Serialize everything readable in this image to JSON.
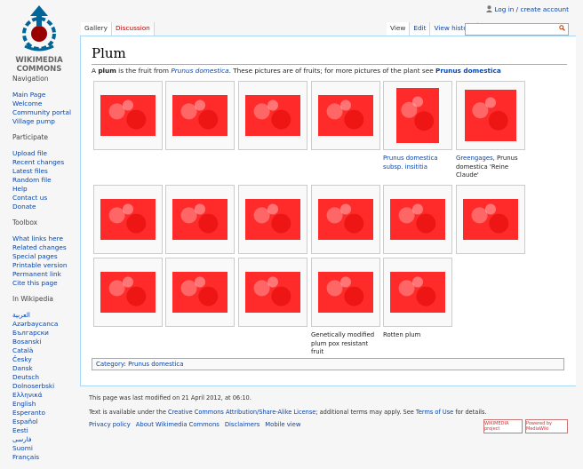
{
  "logo": {
    "line1": "WIKIMEDIA",
    "line2": "COMMONS"
  },
  "personal": {
    "login": "Log in / create account"
  },
  "tabs": {
    "gallery": "Gallery",
    "discussion": "Discussion",
    "view": "View",
    "edit": "Edit",
    "history": "View history"
  },
  "search": {
    "placeholder": ""
  },
  "sidebar": {
    "navigation": {
      "title": "Navigation",
      "items": [
        "Main Page",
        "Welcome",
        "Community portal",
        "Village pump"
      ]
    },
    "participate": {
      "title": "Participate",
      "items": [
        "Upload file",
        "Recent changes",
        "Latest files",
        "Random file",
        "Help",
        "Contact us",
        "Donate"
      ]
    },
    "toolbox": {
      "title": "Toolbox",
      "items": [
        "What links here",
        "Related changes",
        "Special pages",
        "Printable version",
        "Permanent link",
        "Cite this page"
      ]
    },
    "languages": {
      "title": "In Wikipedia",
      "items": [
        "العربية",
        "Azərbaycanca",
        "Български",
        "Bosanski",
        "Català",
        "Česky",
        "Dansk",
        "Deutsch",
        "Dolnoserbski",
        "Ελληνικά",
        "English",
        "Esperanto",
        "Español",
        "Eesti",
        "فارسی",
        "Suomi",
        "Français"
      ]
    }
  },
  "page": {
    "title": "Plum",
    "intro_a": "A ",
    "intro_bold": "plum",
    "intro_b": " is the fruit from ",
    "intro_italic": "Prunus domestica",
    "intro_c": ". These pictures are of fruits; for more pictures of the plant see ",
    "intro_link": "Prunus domestica"
  },
  "gallery": [
    {
      "caption_link": "",
      "caption_text": ""
    },
    {
      "caption_link": "",
      "caption_text": ""
    },
    {
      "caption_link": "",
      "caption_text": ""
    },
    {
      "caption_link": "",
      "caption_text": ""
    },
    {
      "caption_link": "Prunus domestica subsp. insititia",
      "caption_text": ""
    },
    {
      "caption_link": "Greengages",
      "caption_text": ", Prunus domestica 'Reine Claude'"
    },
    {
      "caption_link": "",
      "caption_text": ""
    },
    {
      "caption_link": "",
      "caption_text": ""
    },
    {
      "caption_link": "",
      "caption_text": ""
    },
    {
      "caption_link": "",
      "caption_text": ""
    },
    {
      "caption_link": "",
      "caption_text": ""
    },
    {
      "caption_link": "",
      "caption_text": ""
    },
    {
      "caption_link": "",
      "caption_text": ""
    },
    {
      "caption_link": "",
      "caption_text": ""
    },
    {
      "caption_link": "",
      "caption_text": ""
    },
    {
      "caption_link": "",
      "caption_text": "Genetically modified plum pox resistant fruit"
    },
    {
      "caption_link": "",
      "caption_text": "Rotten plum"
    }
  ],
  "category": {
    "label": "Category",
    "colon": ": ",
    "value": "Prunus domestica"
  },
  "footer": {
    "modified": "This page was last modified on 21 April 2012, at 06:10.",
    "license_a": "Text is available under the ",
    "license_link": "Creative Commons Attribution/Share-Alike License",
    "license_b": "; additional terms may apply. See ",
    "terms_link": "Terms of Use",
    "license_c": " for details.",
    "links": [
      "Privacy policy",
      "About Wikimedia Commons",
      "Disclaimers",
      "Mobile view"
    ],
    "badge_wikimedia": "WIKIMEDIA project",
    "badge_mediawiki": "Powered by MediaWiki"
  },
  "colors": {
    "link": "#0645ad",
    "thumb_tint": "#ff2b2b",
    "new_link": "#ba0000"
  }
}
